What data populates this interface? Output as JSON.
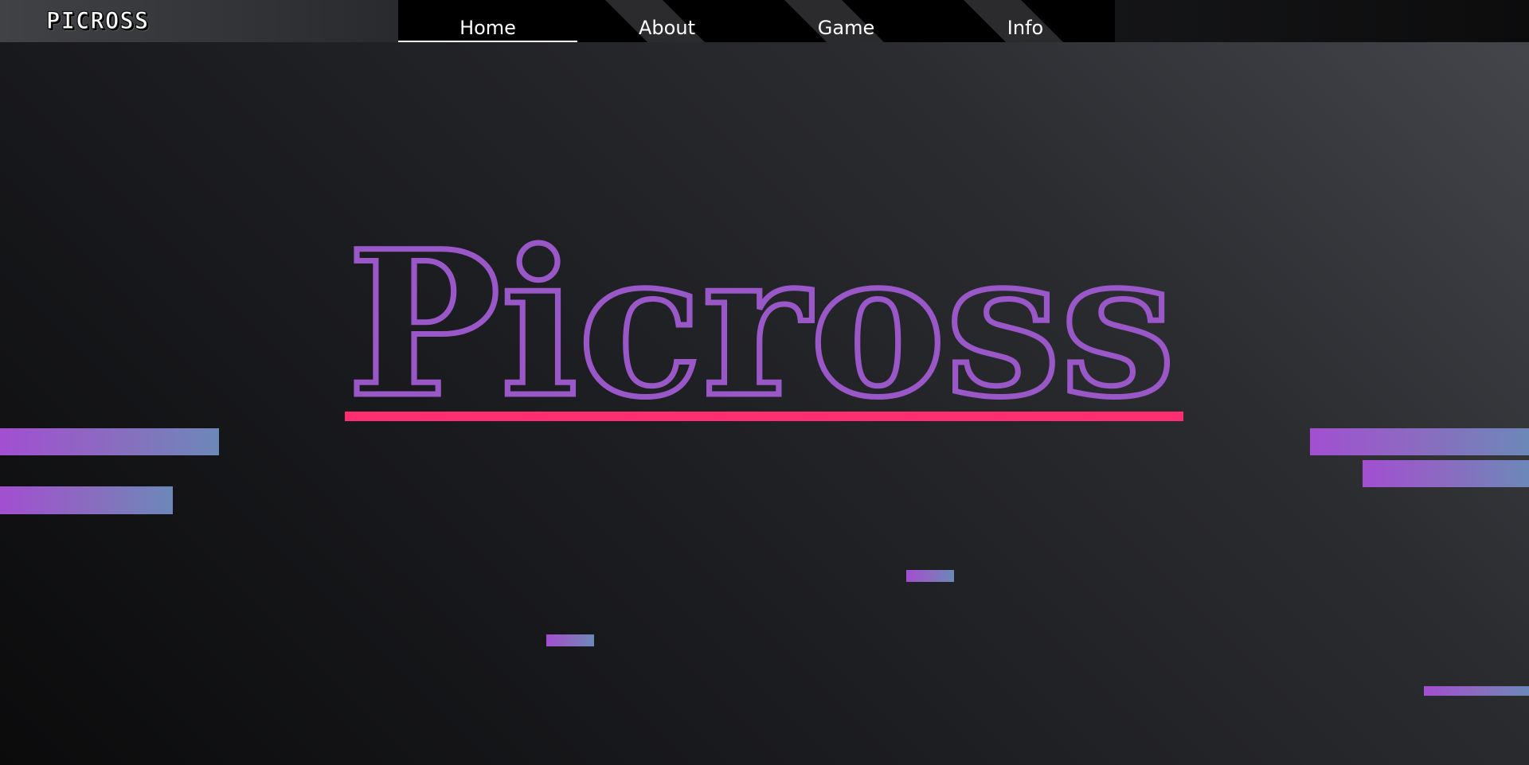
{
  "header": {
    "logo": "PICROSS"
  },
  "nav": {
    "items": [
      {
        "label": "Home",
        "active": true
      },
      {
        "label": "About",
        "active": false
      },
      {
        "label": "Game",
        "active": false
      },
      {
        "label": "Info",
        "active": false
      }
    ]
  },
  "hero": {
    "title": "Picross"
  },
  "colors": {
    "title_stroke": "#9a57c8",
    "underline": "#ff2e71",
    "bar_gradient_start": "#a24fd1",
    "bar_gradient_end": "#6c88b8"
  }
}
